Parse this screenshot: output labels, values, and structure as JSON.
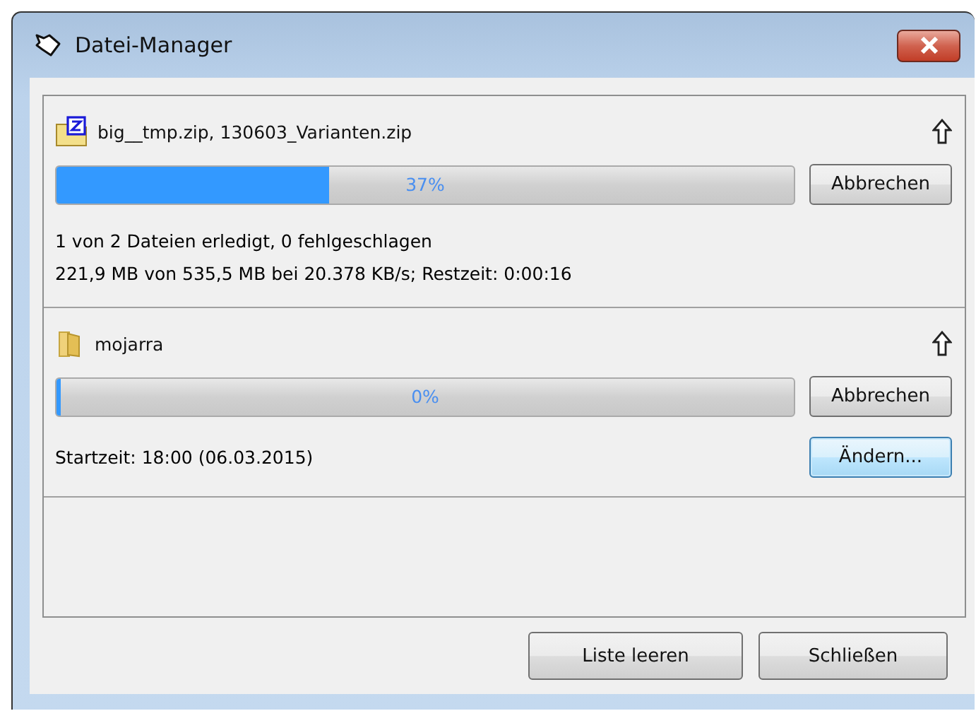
{
  "window": {
    "title": "Datei-Manager"
  },
  "items": [
    {
      "kind": "archive",
      "name": "big__tmp.zip, 130603_Varianten.zip",
      "level": 0.37,
      "percent": "37%",
      "cancel_button": "Abbrechen",
      "details": [
        "1 von 2 Dateien erledigt, 0 fehlgeschlagen",
        "221,9 MB von 535,5 MB bei 20.378 KB/s; Restzeit: 0:00:16"
      ]
    },
    {
      "kind": "folder",
      "name": "mojarra",
      "level": 0.0,
      "percent": "0%",
      "cancel_button": "Abbrechen",
      "start_time": "Startzeit: 18:00 (06.03.2015)",
      "change_button": {
        "label": "Ändern...",
        "focused": true
      }
    }
  ],
  "buttons": [
    "Liste leeren",
    "Schließen"
  ]
}
